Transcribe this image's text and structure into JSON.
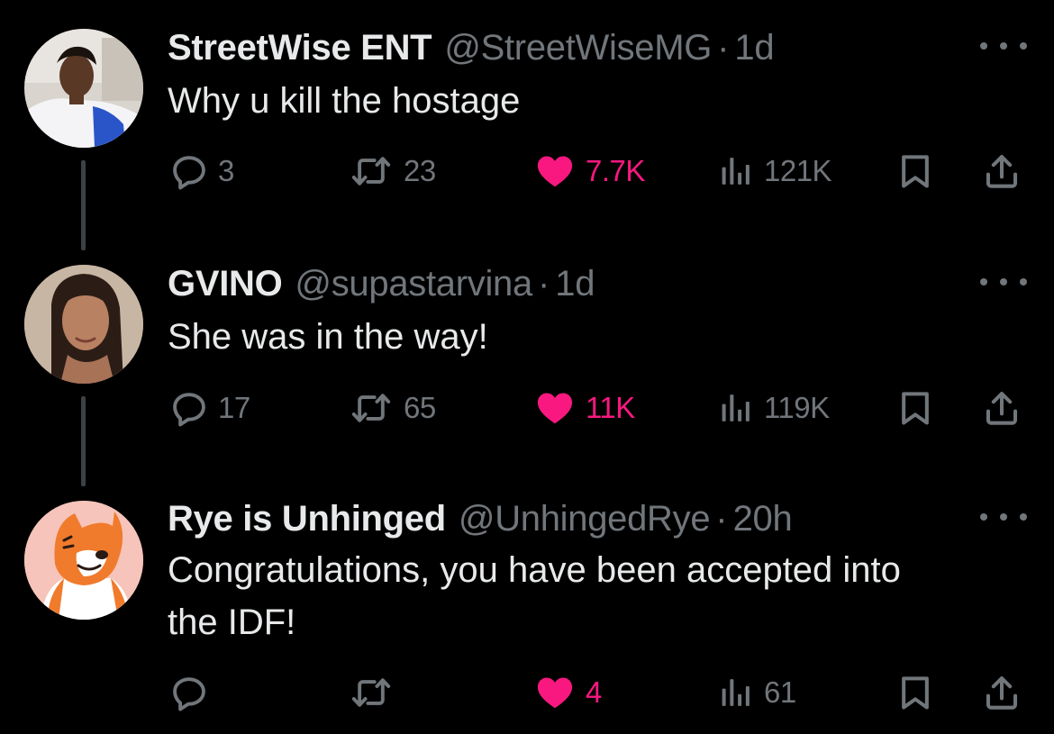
{
  "tweets": [
    {
      "display_name": "StreetWise ENT",
      "handle": "@StreetWiseMG",
      "separator": "·",
      "time": "1d",
      "text": "Why u kill the hostage",
      "replies": "3",
      "retweets": "23",
      "likes": "7.7K",
      "views": "121K"
    },
    {
      "display_name": "GVINO",
      "handle": "@supastarvina",
      "separator": "·",
      "time": "1d",
      "text": "She was in the way!",
      "replies": "17",
      "retweets": "65",
      "likes": "11K",
      "views": "119K"
    },
    {
      "display_name": "Rye is Unhinged",
      "handle": "@UnhingedRye",
      "separator": "·",
      "time": "20h",
      "text_line1": "Congratulations, you have been accepted into",
      "text_line2": "the IDF!",
      "replies": "",
      "retweets": "",
      "likes": "4",
      "views": "61"
    }
  ],
  "colors": {
    "background": "#000000",
    "text_primary": "#e7e9ea",
    "text_secondary": "#71767b",
    "like_pink": "#f91880",
    "thread_line": "#3e4144"
  },
  "icons": [
    "reply-icon",
    "retweet-icon",
    "heart-icon",
    "views-icon",
    "bookmark-icon",
    "share-icon",
    "more-icon"
  ]
}
